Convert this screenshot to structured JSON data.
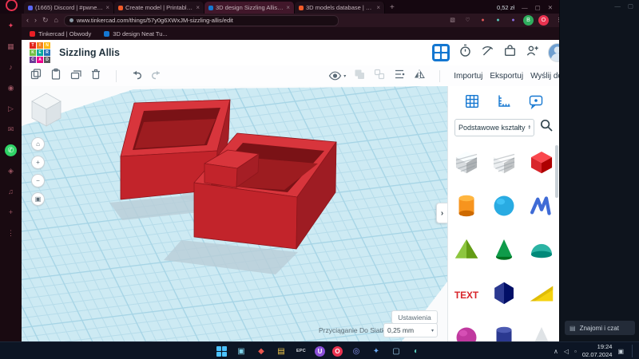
{
  "browser": {
    "new_tab": "+",
    "window_controls": [
      "—",
      "▢",
      "✕"
    ],
    "price_badge": "0,52 zł",
    "url": "www.tinkercad.com/things/57y0g6XWxJM-sizzling-allis/edit",
    "nav": {
      "back": "‹",
      "forward": "›",
      "refresh": "↻",
      "home": "⌂"
    },
    "tabs": [
      {
        "label": "(1665) Discord | #pwneral...",
        "color": "#5865f2",
        "active": false
      },
      {
        "label": "Create model | Printables...",
        "color": "#f05a28",
        "active": false
      },
      {
        "label": "3D design Sizzling Allis - Ti...",
        "color": "#1477d1",
        "active": true
      },
      {
        "label": "3D models database | Prin...",
        "color": "#f05a28",
        "active": false
      }
    ],
    "addr_icons": [
      {
        "name": "capture-icon",
        "glyph": "▧",
        "color": "#a18b94"
      },
      {
        "name": "wishlist-icon",
        "glyph": "♡",
        "color": "#a18b94"
      },
      {
        "name": "extension-dot-icon",
        "glyph": "●",
        "color": "#e05858"
      },
      {
        "name": "extension-dot-icon",
        "glyph": "●",
        "color": "#58c7b8"
      },
      {
        "name": "extension-dot-icon",
        "glyph": "●",
        "color": "#8a6de0"
      },
      {
        "name": "profile-badge",
        "glyph": "B",
        "color": "#ffffff",
        "bg": "#2fae5e"
      },
      {
        "name": "gx-badge-icon",
        "glyph": "O",
        "color": "#ffffff",
        "bg": "#e8324f"
      },
      {
        "name": "menu-dots-icon",
        "glyph": "⋮",
        "color": "#b5a2aa"
      }
    ],
    "bookmarks": [
      {
        "label": "Tinkercad | Obwody",
        "color": "#e81e25"
      },
      {
        "label": "3D design Neat Tu...",
        "color": "#1477d1"
      }
    ]
  },
  "gx_sidebar": {
    "icons": [
      {
        "name": "gx-corner-icon",
        "glyph": "✦",
        "color": "#e8405f"
      },
      {
        "name": "speed-dial-icon",
        "glyph": "▦",
        "color": "#9c5562"
      },
      {
        "name": "gx-player-icon",
        "glyph": "♪",
        "color": "#9c5562"
      },
      {
        "name": "discord-icon",
        "glyph": "◉",
        "color": "#9c5562"
      },
      {
        "name": "twitch-icon",
        "glyph": "▷",
        "color": "#9c5562"
      },
      {
        "name": "messenger-icon",
        "glyph": "✉",
        "color": "#9c5562"
      },
      {
        "name": "whatsapp-icon",
        "glyph": "✆",
        "color": "#ffffff",
        "bg": "#2fd366"
      },
      {
        "name": "instagram-icon",
        "glyph": "◈",
        "color": "#9c5562"
      },
      {
        "name": "tiktok-icon",
        "glyph": "♫",
        "color": "#9c5562"
      },
      {
        "name": "add-app-icon",
        "glyph": "+",
        "color": "#9c5562"
      },
      {
        "name": "sidebar-settings-icon",
        "glyph": "⋮",
        "color": "#9c5562"
      }
    ]
  },
  "tinkercad": {
    "design_title": "Sizzling Allis",
    "logo_tiles": [
      {
        "letter": "T",
        "color": "#e2231a"
      },
      {
        "letter": "I",
        "color": "#f5821f"
      },
      {
        "letter": "N",
        "color": "#fdb813"
      },
      {
        "letter": "K",
        "color": "#72bf44"
      },
      {
        "letter": "E",
        "color": "#00a69c"
      },
      {
        "letter": "R",
        "color": "#236fb5"
      },
      {
        "letter": "C",
        "color": "#6a3b96"
      },
      {
        "letter": "A",
        "color": "#ec008c"
      },
      {
        "letter": "D",
        "color": "#58595b"
      }
    ],
    "toolbar": {
      "import_label": "Importuj",
      "export_label": "Eksportuj",
      "send_to_label": "Wyślij do",
      "eye_caret": "▾"
    },
    "panel": {
      "category_label": "Podstawowe kształty",
      "caret_up": "▴",
      "caret_down": "▾",
      "shapes": [
        {
          "name": "box-striped",
          "type": "cube",
          "color": "#d8dcdf",
          "striped": true
        },
        {
          "name": "box-hole-striped",
          "type": "cube",
          "color": "#eceff1",
          "striped": true
        },
        {
          "name": "box",
          "type": "cube",
          "color": "#d8252b"
        },
        {
          "name": "cylinder",
          "type": "cylinder",
          "color": "#f7941e"
        },
        {
          "name": "sphere",
          "type": "sphere",
          "color": "#29abe2"
        },
        {
          "name": "scribble",
          "type": "scribble",
          "color": "#3f6bd6"
        },
        {
          "name": "pyramid",
          "type": "pyramid",
          "color": "#8dc63f"
        },
        {
          "name": "cone",
          "type": "cone",
          "color": "#0f9b4a"
        },
        {
          "name": "half-sphere",
          "type": "dome",
          "color": "#2bb3a3"
        },
        {
          "name": "text",
          "type": "text",
          "color": "#d8252b",
          "label": "TEXT"
        },
        {
          "name": "polygon",
          "type": "prism",
          "color": "#2b3990"
        },
        {
          "name": "wedge",
          "type": "wedge",
          "color": "#f5d20f"
        },
        {
          "name": "sphere-magenta",
          "type": "sphere",
          "color": "#c0399f"
        },
        {
          "name": "tube",
          "type": "cylinder",
          "color": "#2b3990"
        },
        {
          "name": "cone-gray",
          "type": "cone",
          "color": "#dfe3e6"
        }
      ]
    },
    "viewport": {
      "settings_label": "Ustawienia",
      "snap_label": "Przyciąganie Do Siatki",
      "snap_value": "0,25 mm",
      "snap_caret": "▾",
      "collapse_glyph": "›",
      "nav": {
        "home": "⌂",
        "zoom_in": "+",
        "zoom_out": "−",
        "fit": "▣"
      }
    }
  },
  "right_panel": {
    "chat_label": "Znajomi i czat",
    "chat_icon_glyph": "▤"
  },
  "taskbar": {
    "time": "19:24",
    "date": "02.07.2024",
    "apps": [
      {
        "name": "taskbar-app-explorer",
        "glyph": "▣",
        "color": "#7fd1e8"
      },
      {
        "name": "taskbar-app-red",
        "glyph": "◆",
        "color": "#e8554d"
      },
      {
        "name": "taskbar-app-folder",
        "glyph": "▤",
        "color": "#f2c94c"
      },
      {
        "name": "taskbar-app-epc",
        "glyph": "EPC",
        "color": "#d9dee3",
        "text": true
      },
      {
        "name": "taskbar-app-u",
        "glyph": "U",
        "color": "#ffffff",
        "bg": "#8a4fd8"
      },
      {
        "name": "taskbar-app-operagx",
        "glyph": "O",
        "color": "#ffffff",
        "bg": "#e8324f"
      },
      {
        "name": "taskbar-app-discord",
        "glyph": "◎",
        "color": "#8a97f2"
      },
      {
        "name": "taskbar-app-blue",
        "glyph": "✦",
        "color": "#6aa8f0"
      },
      {
        "name": "taskbar-app-paint",
        "glyph": "▢",
        "color": "#9fd3f0"
      },
      {
        "name": "taskbar-app-teal",
        "glyph": "◐",
        "color": "#58c7b8"
      }
    ],
    "tray": [
      {
        "name": "tray-chevron-icon",
        "glyph": "∧",
        "color": "#c3cdd6"
      },
      {
        "name": "tray-network-icon",
        "glyph": "◁",
        "color": "#c3cdd6"
      },
      {
        "name": "tray-volume-icon",
        "glyph": "▫",
        "color": "#c3cdd6"
      }
    ],
    "notification_glyph": "▣"
  }
}
